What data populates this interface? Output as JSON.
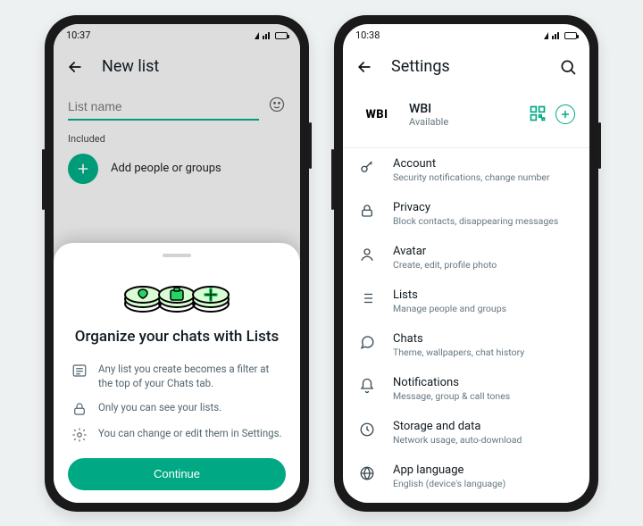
{
  "accent": "#00a884",
  "left": {
    "time": "10:37",
    "appbar_title": "New list",
    "input_placeholder": "List name",
    "included_label": "Included",
    "add_label": "Add people or groups",
    "sheet": {
      "title": "Organize your chats with Lists",
      "points": [
        "Any list you create becomes a filter at the top of your Chats tab.",
        "Only you can see your lists.",
        "You can change or edit them in Settings."
      ],
      "cta": "Continue"
    }
  },
  "right": {
    "time": "10:38",
    "appbar_title": "Settings",
    "profile": {
      "avatar_text": "WBI",
      "name": "WBI",
      "status": "Available"
    },
    "items": [
      {
        "icon": "key",
        "label": "Account",
        "sub": "Security notifications, change number"
      },
      {
        "icon": "lock",
        "label": "Privacy",
        "sub": "Block contacts, disappearing messages"
      },
      {
        "icon": "avatar",
        "label": "Avatar",
        "sub": "Create, edit, profile photo"
      },
      {
        "icon": "list",
        "label": "Lists",
        "sub": "Manage people and groups"
      },
      {
        "icon": "chat",
        "label": "Chats",
        "sub": "Theme, wallpapers, chat history"
      },
      {
        "icon": "bell",
        "label": "Notifications",
        "sub": "Message, group & call tones"
      },
      {
        "icon": "storage",
        "label": "Storage and data",
        "sub": "Network usage, auto-download"
      },
      {
        "icon": "globe",
        "label": "App language",
        "sub": "English (device's language)"
      }
    ]
  }
}
